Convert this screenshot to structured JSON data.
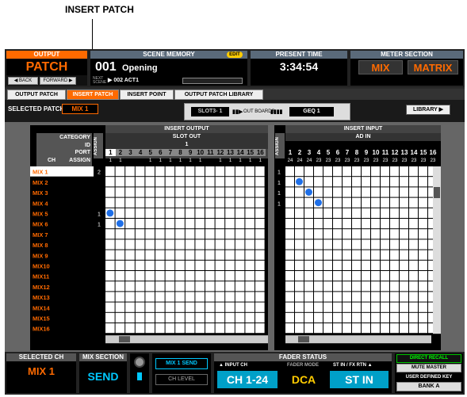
{
  "callout": {
    "label": "INSERT PATCH"
  },
  "header": {
    "function": {
      "title": "OUTPUT",
      "name": "PATCH",
      "back": "◀ BACK",
      "forward": "FORWARD ▶"
    },
    "scene": {
      "title": "SCENE MEMORY",
      "edit": "EDIT",
      "number": "001",
      "name": "Opening",
      "next_label": "NEXT SCENE",
      "next_value": "▶ 002 ACT1"
    },
    "time": {
      "title": "PRESENT TIME",
      "value": "3:34:54"
    },
    "meter": {
      "title": "METER SECTION",
      "mix": "MIX",
      "matrix": "MATRIX"
    }
  },
  "tabs": [
    {
      "label": "OUTPUT PATCH",
      "active": false
    },
    {
      "label": "INSERT PATCH",
      "active": true
    },
    {
      "label": "INSERT POINT",
      "active": false
    },
    {
      "label": "OUTPUT PATCH LIBRARY",
      "active": false
    }
  ],
  "subbar": {
    "selected_patch_label": "SELECTED PATCH",
    "selected_patch_value": "MIX 1",
    "slot_value": "SLOT3- 1",
    "slot_arrow": "▮▮▶",
    "out_boards_label": "OUT BOARDS",
    "out_boards_bars": "▮▮▮▮",
    "geq_value": "GEQ 1",
    "library_button": "LIBRARY ▶"
  },
  "left_matrix": {
    "header": "INSERT OUTPUT",
    "subheader": "SLOT OUT",
    "slot_number": "1",
    "assign_label": "ASSIGN",
    "category_label": "CATEGORY",
    "id_label": "ID",
    "port_label": "PORT",
    "ch_label": "CH",
    "assign_col_label": "ASSIGN",
    "columns": [
      "1",
      "2",
      "3",
      "4",
      "5",
      "6",
      "7",
      "8",
      "9",
      "10",
      "11",
      "12",
      "13",
      "14",
      "15",
      "16"
    ],
    "column_sub": [
      "1",
      "1",
      "",
      "",
      "1",
      "1",
      "1",
      "1",
      "1",
      "1",
      "",
      "1",
      "1",
      "1",
      "1",
      "1"
    ],
    "rows": [
      {
        "label": "MIX 1",
        "assign": "2",
        "selected": true
      },
      {
        "label": "MIX 2",
        "assign": ""
      },
      {
        "label": "MIX 3",
        "assign": ""
      },
      {
        "label": "MIX 4",
        "assign": ""
      },
      {
        "label": "MIX 5",
        "assign": "1"
      },
      {
        "label": "MIX 6",
        "assign": "1"
      },
      {
        "label": "MIX 7",
        "assign": ""
      },
      {
        "label": "MIX 8",
        "assign": ""
      },
      {
        "label": "MIX 9",
        "assign": ""
      },
      {
        "label": "MIX10",
        "assign": ""
      },
      {
        "label": "MIX11",
        "assign": ""
      },
      {
        "label": "MIX12",
        "assign": ""
      },
      {
        "label": "MIX13",
        "assign": ""
      },
      {
        "label": "MIX14",
        "assign": ""
      },
      {
        "label": "MIX15",
        "assign": ""
      },
      {
        "label": "MIX16",
        "assign": ""
      }
    ],
    "dots": [
      {
        "row": 4,
        "col": 0
      },
      {
        "row": 5,
        "col": 1
      }
    ]
  },
  "right_matrix": {
    "header": "INSERT INPUT",
    "subheader": "AD IN",
    "assign_label": "ASSIGN",
    "columns": [
      "1",
      "2",
      "3",
      "4",
      "5",
      "6",
      "7",
      "8",
      "9",
      "10",
      "11",
      "12",
      "13",
      "14",
      "15",
      "16"
    ],
    "column_sub": [
      "24",
      "24",
      "24",
      "23",
      "23",
      "23",
      "23",
      "23",
      "23",
      "23",
      "23",
      "23",
      "23",
      "23",
      "23",
      "23"
    ],
    "row_assign": [
      "1",
      "1",
      "1",
      "1",
      "",
      "",
      "",
      "",
      "",
      "",
      "",
      "",
      "",
      "",
      "",
      ""
    ],
    "dots": [
      {
        "row": 1,
        "col": 1
      },
      {
        "row": 2,
        "col": 2
      },
      {
        "row": 3,
        "col": 3
      }
    ]
  },
  "statusbar": {
    "selected_ch_title": "SELECTED CH",
    "selected_ch_value": "MIX 1",
    "mix_section_title": "MIX SECTION",
    "mix_section_value": "SEND",
    "mix1_send": "MIX 1 SEND",
    "ch_level": "CH LEVEL",
    "fader_status_title": "FADER STATUS",
    "input_ch_label": "▲ INPUT CH",
    "input_ch_value": "CH 1-24",
    "fader_mode_label": "FADER MODE",
    "fader_mode_value": "DCA",
    "st_label": "ST IN / FX RTN ▲",
    "st_value": "ST IN",
    "direct_recall": "DIRECT RECALL",
    "mute_master": "MUTE MASTER",
    "user_defined": "USER DEFINED KEY",
    "bank": "BANK A"
  },
  "colors": {
    "accent": "#ff6a00",
    "cyan": "#00a0c8",
    "dot": "#1e6fe8",
    "grid_bg": "#ffffff"
  }
}
